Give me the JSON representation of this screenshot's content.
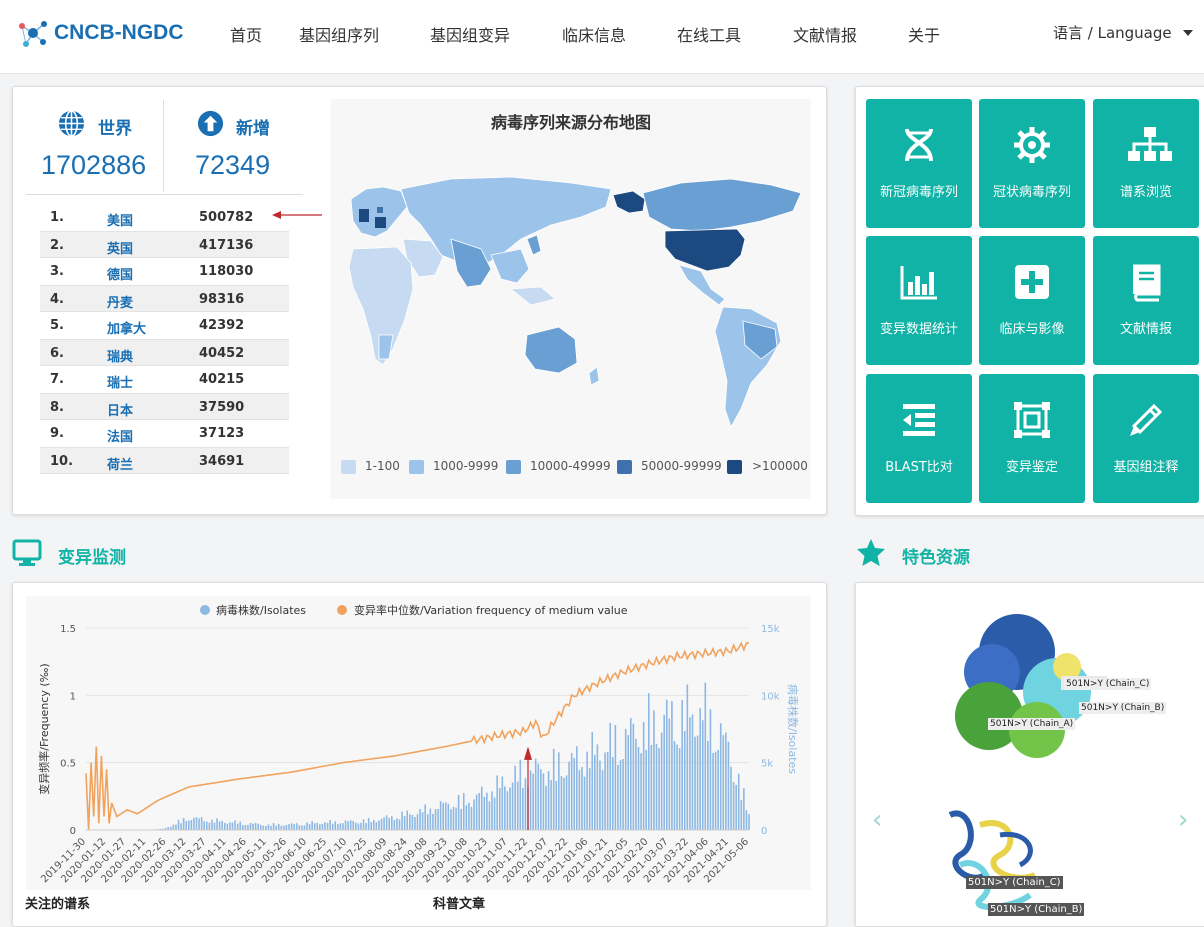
{
  "header": {
    "logo": "CNCB-NGDC",
    "nav": [
      "首页",
      "基因组序列",
      "基因组变异",
      "临床信息",
      "在线工具",
      "文献情报",
      "关于"
    ],
    "language": "语言 / Language"
  },
  "stats": {
    "world_label": "世界",
    "world_value": "1702886",
    "new_label": "新增",
    "new_value": "72349"
  },
  "ranking": [
    {
      "idx": "1.",
      "country": "美国",
      "value": "500782"
    },
    {
      "idx": "2.",
      "country": "英国",
      "value": "417136"
    },
    {
      "idx": "3.",
      "country": "德国",
      "value": "118030"
    },
    {
      "idx": "4.",
      "country": "丹麦",
      "value": "98316"
    },
    {
      "idx": "5.",
      "country": "加拿大",
      "value": "42392"
    },
    {
      "idx": "6.",
      "country": "瑞典",
      "value": "40452"
    },
    {
      "idx": "7.",
      "country": "瑞士",
      "value": "40215"
    },
    {
      "idx": "8.",
      "country": "日本",
      "value": "37590"
    },
    {
      "idx": "9.",
      "country": "法国",
      "value": "37123"
    },
    {
      "idx": "10.",
      "country": "荷兰",
      "value": "34691"
    }
  ],
  "map": {
    "title": "病毒序列来源分布地图",
    "legend": [
      {
        "label": "1-100",
        "color": "#c6dbf2"
      },
      {
        "label": "1000-9999",
        "color": "#9cc3ea"
      },
      {
        "label": "10000-49999",
        "color": "#6a9fd4"
      },
      {
        "label": "50000-99999",
        "color": "#3f72ad"
      },
      {
        "label": ">100000",
        "color": "#1c4a80"
      }
    ]
  },
  "tiles": [
    {
      "label": "新冠病毒序列",
      "icon": "dna-icon"
    },
    {
      "label": "冠状病毒序列",
      "icon": "gear-icon"
    },
    {
      "label": "谱系浏览",
      "icon": "sitemap-icon"
    },
    {
      "label": "变异数据统计",
      "icon": "bar-chart-icon"
    },
    {
      "label": "临床与影像",
      "icon": "medical-plus-icon"
    },
    {
      "label": "文献情报",
      "icon": "book-icon"
    },
    {
      "label": "BLAST比对",
      "icon": "align-icon"
    },
    {
      "label": "变异鉴定",
      "icon": "object-select-icon"
    },
    {
      "label": "基因组注释",
      "icon": "pencil-icon"
    }
  ],
  "sections": {
    "variation_monitor": "变异监测",
    "featured": "特色资源",
    "lineages": "关注的谱系",
    "articles": "科普文章"
  },
  "featured": {
    "labels": [
      "501N>Y (Chain_C)",
      "501N>Y (Chain_B)",
      "501N>Y (Chain_A)",
      "501N>Y (Chain_C)",
      "501N>Y (Chain_B)"
    ],
    "prev": "‹",
    "next": "›"
  },
  "chart_data": {
    "type": "bar+line",
    "legend": [
      "病毒株数/Isolates",
      "变异率中位数/Variation frequency of medium value"
    ],
    "ylabel_left": "变异频率/Frequency (‰)",
    "ylabel_right": "病毒株数/Isolates",
    "y_left_ticks": [
      "0",
      "0.5",
      "1",
      "1.5"
    ],
    "y_left_range": [
      0,
      1.5
    ],
    "y_right_ticks": [
      "0",
      "5k",
      "10k",
      "15k"
    ],
    "y_right_range": [
      0,
      15000
    ],
    "x_ticks": [
      "2019-11-30",
      "2020-01-12",
      "2020-01-27",
      "2020-02-11",
      "2020-02-26",
      "2020-03-12",
      "2020-03-27",
      "2020-04-11",
      "2020-04-26",
      "2020-05-11",
      "2020-05-26",
      "2020-06-10",
      "2020-06-25",
      "2020-07-10",
      "2020-07-25",
      "2020-08-09",
      "2020-08-24",
      "2020-09-08",
      "2020-09-23",
      "2020-10-08",
      "2020-10-23",
      "2020-11-07",
      "2020-11-22",
      "2020-12-07",
      "2020-12-22",
      "2021-01-06",
      "2021-01-21",
      "2021-02-05",
      "2021-02-20",
      "2021-03-07",
      "2021-03-22",
      "2021-04-06",
      "2021-04-21",
      "2021-05-06"
    ],
    "series": [
      {
        "name": "变异率中位数/Variation frequency of medium value",
        "color": "#f0a35e",
        "points": [
          [
            0,
            0.42
          ],
          [
            1,
            0.0
          ],
          [
            2,
            0.5
          ],
          [
            3,
            0.1
          ],
          [
            4,
            0.62
          ],
          [
            5,
            0.05
          ],
          [
            6,
            0.55
          ],
          [
            7,
            0.1
          ],
          [
            8,
            0.45
          ],
          [
            9,
            0.05
          ],
          [
            10,
            0.2
          ],
          [
            12,
            0.1
          ],
          [
            16,
            0.15
          ],
          [
            20,
            0.12
          ],
          [
            28,
            0.22
          ],
          [
            40,
            0.32
          ],
          [
            60,
            0.38
          ],
          [
            80,
            0.43
          ],
          [
            100,
            0.5
          ],
          [
            120,
            0.55
          ],
          [
            140,
            0.62
          ],
          [
            160,
            0.7
          ],
          [
            170,
            0.73
          ],
          [
            175,
            0.8
          ],
          [
            178,
            0.68
          ],
          [
            182,
            0.8
          ],
          [
            190,
            1.0
          ],
          [
            200,
            1.1
          ],
          [
            210,
            1.18
          ],
          [
            220,
            1.24
          ],
          [
            230,
            1.29
          ],
          [
            240,
            1.31
          ],
          [
            250,
            1.33
          ],
          [
            258,
            1.38
          ]
        ]
      },
      {
        "name": "病毒株数/Isolates",
        "color": "#8db8e3",
        "points": [
          [
            0,
            0
          ],
          [
            20,
            0
          ],
          [
            30,
            100
          ],
          [
            40,
            1200
          ],
          [
            50,
            900
          ],
          [
            60,
            700
          ],
          [
            70,
            500
          ],
          [
            80,
            550
          ],
          [
            90,
            700
          ],
          [
            100,
            800
          ],
          [
            110,
            900
          ],
          [
            120,
            1300
          ],
          [
            130,
            1800
          ],
          [
            140,
            2500
          ],
          [
            150,
            3000
          ],
          [
            160,
            4200
          ],
          [
            170,
            5600
          ],
          [
            180,
            6000
          ],
          [
            190,
            6700
          ],
          [
            200,
            7800
          ],
          [
            210,
            9000
          ],
          [
            220,
            10300
          ],
          [
            230,
            11000
          ],
          [
            240,
            11500
          ],
          [
            250,
            8000
          ],
          [
            258,
            1500
          ]
        ]
      }
    ],
    "x_count": 259
  }
}
